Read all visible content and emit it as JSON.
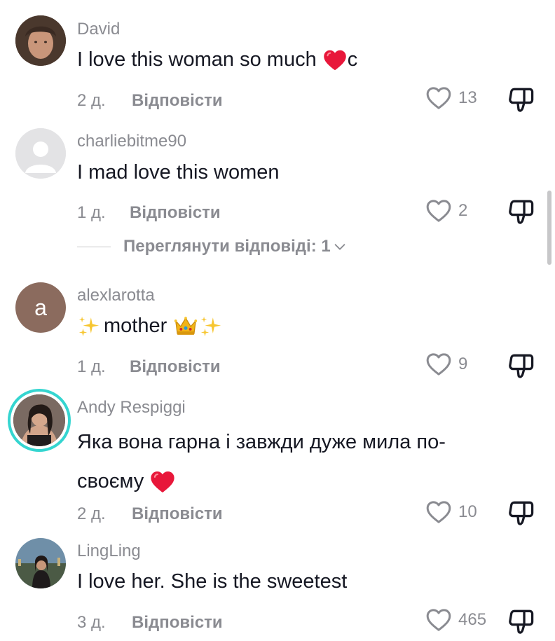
{
  "comments": [
    {
      "username": "David",
      "text_before": "I love this woman so much ",
      "text_after": "c",
      "time": "2 д.",
      "reply_label": "Відповісти",
      "likes": "13"
    },
    {
      "username": "charliebitme90",
      "text": "I mad love this women",
      "time": "1 д.",
      "reply_label": "Відповісти",
      "likes": "2",
      "view_replies": "Переглянути відповіді: 1"
    },
    {
      "username": "alexlarotta",
      "avatar_letter": "a",
      "text": "mother",
      "time": "1 д.",
      "reply_label": "Відповісти",
      "likes": "9"
    },
    {
      "username": "Andy Respiggi",
      "text_line1": "Яка вона гарна і завжди дуже мила по-",
      "text_line2": "своєму ",
      "time": "2 д.",
      "reply_label": "Відповісти",
      "likes": "10"
    },
    {
      "username": "LingLing",
      "text": "I love her. She is the sweetest",
      "time": "3 д.",
      "reply_label": "Відповісти",
      "likes": "465"
    }
  ],
  "colors": {
    "text_primary": "#161823",
    "text_secondary": "#8a8b91",
    "heart_emoji": "#e8173a",
    "story_ring": "#35d5d0"
  }
}
